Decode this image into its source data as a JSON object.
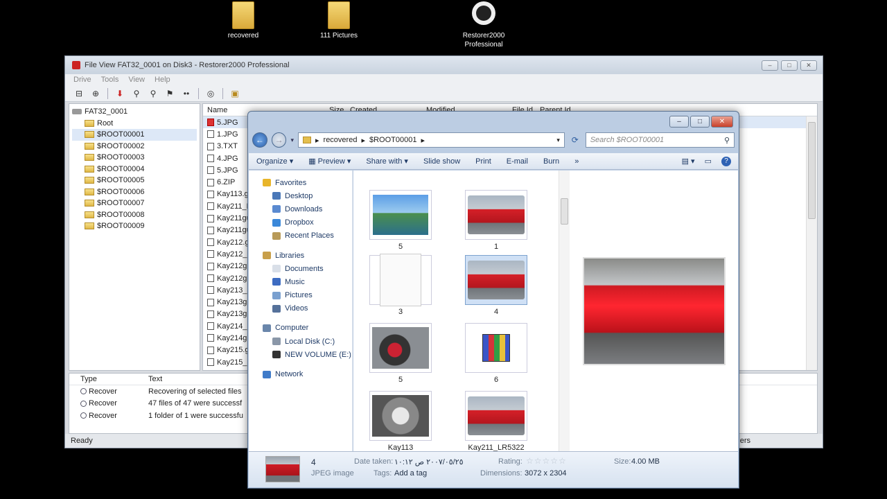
{
  "desktop": {
    "icons": [
      {
        "label": "recovered",
        "icon": "folder-icon"
      },
      {
        "label": "111 Pictures",
        "icon": "folder-icon"
      },
      {
        "label": "Restorer2000 Professional",
        "icon": "restorer-app-icon"
      }
    ]
  },
  "restorer": {
    "title": "File View FAT32_0001 on Disk3 - Restorer2000 Professional",
    "menu": [
      "Drive",
      "Tools",
      "View",
      "Help"
    ],
    "tree": {
      "root_drive": "FAT32_0001",
      "items": [
        "Root",
        "$ROOT00001",
        "$ROOT00002",
        "$ROOT00003",
        "$ROOT00004",
        "$ROOT00005",
        "$ROOT00006",
        "$ROOT00007",
        "$ROOT00008",
        "$ROOT00009"
      ]
    },
    "file_columns": [
      "Name",
      "Size",
      "Created",
      "Modified",
      "File Id",
      "Parent Id"
    ],
    "files": [
      "5.JPG",
      "1.JPG",
      "3.TXT",
      "4.JPG",
      "5.JPG",
      "6.ZIP",
      "Kay113.gi",
      "Kay211_LI",
      "Kay211gu",
      "Kay211gu",
      "Kay212.gi",
      "Kay212_LI",
      "Kay212gu",
      "Kay212gu",
      "Kay213_LI",
      "Kay213gu",
      "Kay213gu",
      "Kay214_LI",
      "Kay214gu",
      "Kay215.gi",
      "Kay215_LI"
    ],
    "log_columns": [
      "Type",
      "Text"
    ],
    "log": [
      {
        "type": "Recover",
        "text": "Recovering of selected files"
      },
      {
        "type": "Recover",
        "text": "47 files of 47 were successf"
      },
      {
        "type": "Recover",
        "text": "1 folder of 1 were successfu"
      }
    ],
    "status_left": "Ready",
    "status_right": "folders"
  },
  "explorer": {
    "breadcrumb": [
      "recovered",
      "$ROOT00001"
    ],
    "search_placeholder": "Search $ROOT00001",
    "commands": [
      "Organize",
      "Preview",
      "Share with",
      "Slide show",
      "Print",
      "E-mail",
      "Burn"
    ],
    "more_glyph": "»",
    "nav": {
      "favorites_label": "Favorites",
      "favorites": [
        "Desktop",
        "Downloads",
        "Dropbox",
        "Recent Places"
      ],
      "libraries_label": "Libraries",
      "libraries": [
        "Documents",
        "Music",
        "Pictures",
        "Videos"
      ],
      "computer_label": "Computer",
      "drives": [
        "Local Disk (C:)",
        "NEW VOLUME (E:)"
      ],
      "network_label": "Network"
    },
    "items": [
      {
        "label": "5",
        "kind": "landscape"
      },
      {
        "label": "1",
        "kind": "car"
      },
      {
        "label": "3",
        "kind": "text-doc"
      },
      {
        "label": "4",
        "kind": "car",
        "selected": true
      },
      {
        "label": "5",
        "kind": "interior"
      },
      {
        "label": "6",
        "kind": "zip"
      },
      {
        "label": "Kay113",
        "kind": "engine"
      },
      {
        "label": "Kay211_LR5322",
        "kind": "car"
      }
    ],
    "details": {
      "name": "4",
      "type": "JPEG image",
      "date_taken_label": "Date taken:",
      "date_taken": "٢٠٠٧/٠٥/٢٥ ص ١٠:١٢",
      "tags_label": "Tags:",
      "tags": "Add a tag",
      "rating_label": "Rating:",
      "rating_stars": "☆☆☆☆☆",
      "dimensions_label": "Dimensions:",
      "dimensions": "3072 x 2304",
      "size_label": "Size:",
      "size": "4.00 MB"
    }
  }
}
